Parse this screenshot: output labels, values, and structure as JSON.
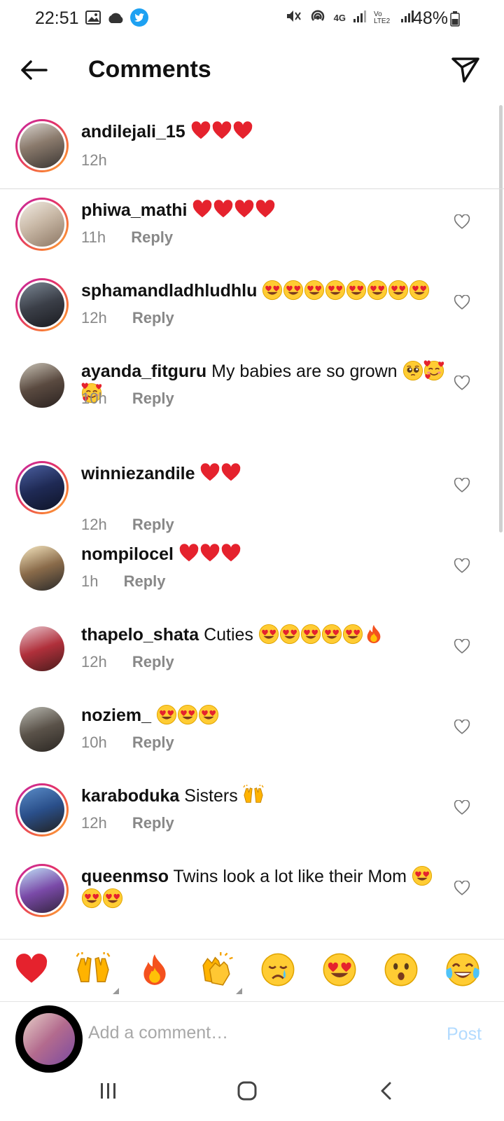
{
  "status_bar": {
    "time": "22:51",
    "network": "4G",
    "volte": "Vo LTE2",
    "battery": "48%"
  },
  "header": {
    "title": "Comments"
  },
  "caption": {
    "username": "andilejali_15",
    "emojis": [
      "red-heart",
      "red-heart",
      "red-heart"
    ],
    "time": "12h"
  },
  "comments": [
    {
      "username": "phiwa_mathi",
      "text": "",
      "emojis": [
        "red-heart",
        "red-heart",
        "red-heart",
        "red-heart"
      ],
      "time": "11h",
      "reply": "Reply"
    },
    {
      "username": "sphamandladhludhlu",
      "text": "",
      "emojis": [
        "heart-eyes",
        "heart-eyes",
        "heart-eyes",
        "heart-eyes",
        "heart-eyes",
        "heart-eyes",
        "heart-eyes",
        "heart-eyes"
      ],
      "time": "12h",
      "reply": "Reply"
    },
    {
      "username": "ayanda_fitguru",
      "text": "My babies are so grown",
      "emojis": [
        "pleading",
        "smiling-hearts",
        "smiling-hearts"
      ],
      "time": "10h",
      "reply": "Reply"
    },
    {
      "username": "winniezandile",
      "text": "",
      "emojis": [
        "red-heart",
        "red-heart"
      ],
      "time": "12h",
      "reply": "Reply"
    },
    {
      "username": "nompilocel",
      "text": "",
      "emojis": [
        "red-heart",
        "red-heart",
        "red-heart"
      ],
      "time": "1h",
      "reply": "Reply"
    },
    {
      "username": "thapelo_shata",
      "text": "Cuties",
      "emojis": [
        "heart-eyes",
        "heart-eyes",
        "heart-eyes",
        "heart-eyes",
        "heart-eyes",
        "fire"
      ],
      "time": "12h",
      "reply": "Reply"
    },
    {
      "username": "noziem_",
      "text": "",
      "emojis": [
        "heart-eyes",
        "heart-eyes",
        "heart-eyes"
      ],
      "time": "10h",
      "reply": "Reply"
    },
    {
      "username": "karaboduka",
      "text": "Sisters",
      "emojis": [
        "raising-hands"
      ],
      "time": "12h",
      "reply": "Reply"
    },
    {
      "username": "queenmso",
      "text": "Twins look a lot like their Mom",
      "emojis": [
        "heart-eyes",
        "heart-eyes",
        "heart-eyes"
      ],
      "time": "",
      "reply": ""
    }
  ],
  "reactions": [
    "red-heart",
    "raising-hands",
    "fire",
    "clapping-hands",
    "crying-face",
    "heart-eyes",
    "hushed-face",
    "tears-of-joy"
  ],
  "comment_input": {
    "placeholder": "Add a comment…",
    "post_label": "Post"
  },
  "colors": {
    "ring_start": "#c32aa3",
    "ring_end": "#fcaf45",
    "post_disabled": "#b3dbff",
    "meta_gray": "#888888"
  }
}
